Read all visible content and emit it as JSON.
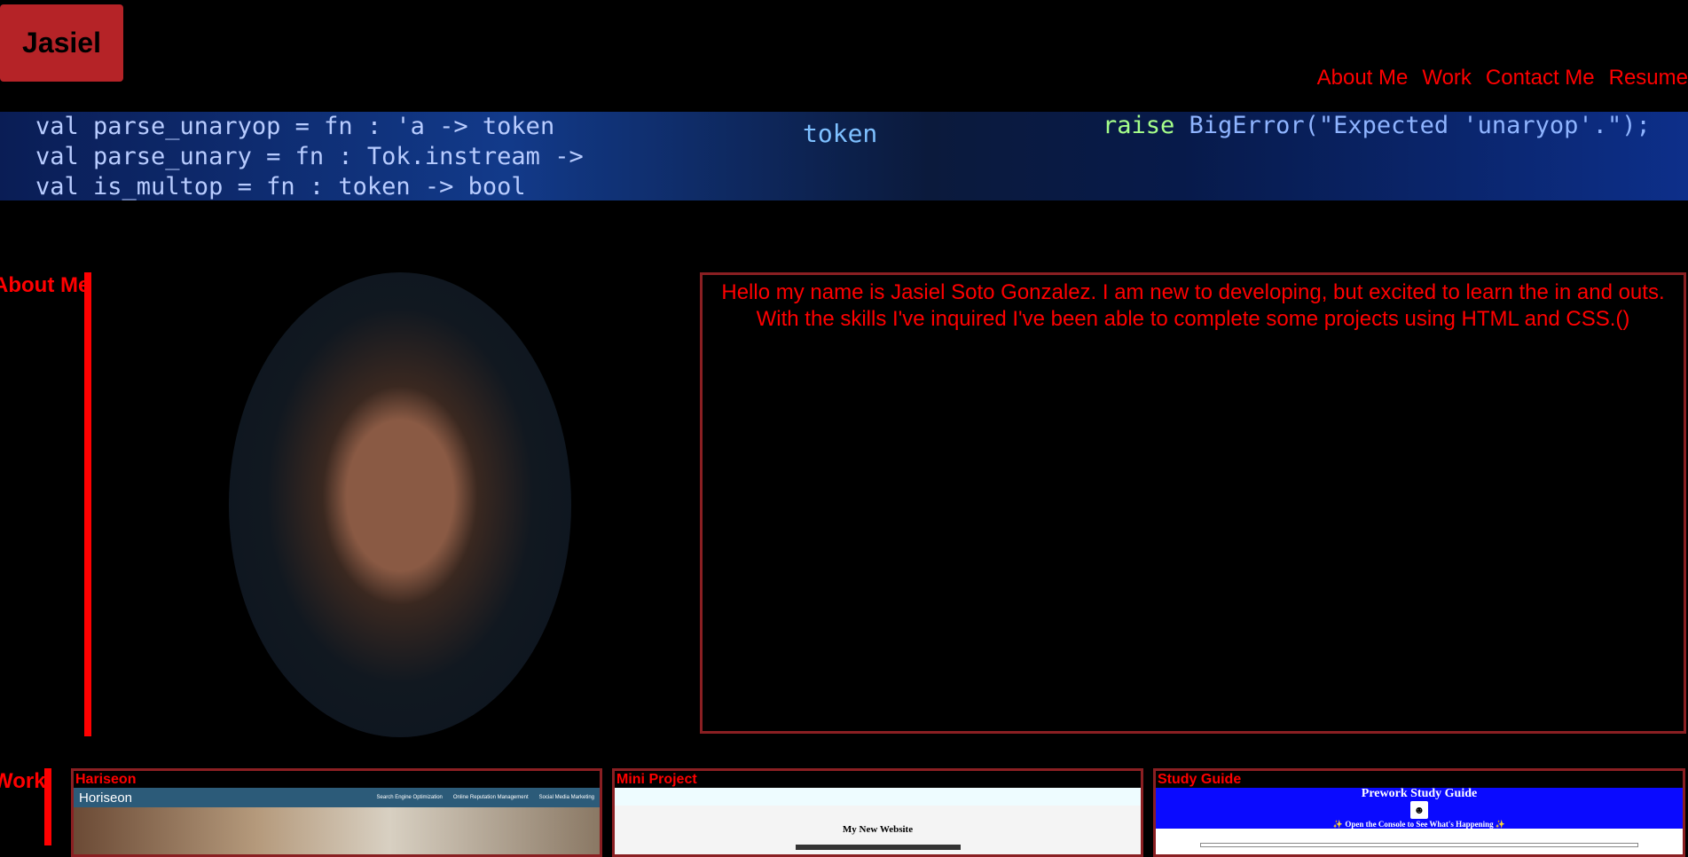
{
  "header": {
    "logo": "Jasiel",
    "nav": [
      "About Me",
      "Work",
      "Contact Me",
      "Resume"
    ]
  },
  "banner": {
    "code_left": [
      "val parse_unaryop = fn : 'a -> token",
      "val parse_unary = fn : Tok.instream ->",
      "val is_multop = fn : token -> bool"
    ],
    "code_middle": "token",
    "code_right_keyword": "raise",
    "code_right_rest": " BigError(\"Expected 'unaryop'.\");"
  },
  "about": {
    "label": "About Me",
    "text": "Hello my name is Jasiel Soto Gonzalez. I am new to developing, but excited to learn the in and outs. With the skills I've inquired I've been able to complete some projects using HTML and CSS.()"
  },
  "work": {
    "label": "Work",
    "cards": [
      {
        "title": "Hariseon",
        "preview_brand": "Horiseon",
        "preview_links": [
          "Search Engine Optimization",
          "Online Reputation Management",
          "Social Media Marketing"
        ]
      },
      {
        "title": "Mini Project",
        "preview_heading": "My New Website"
      },
      {
        "title": "Study Guide",
        "preview_heading": "Prework Study Guide",
        "preview_note": "✨ Open the Console to See What's Happening ✨"
      }
    ]
  },
  "colors": {
    "accent": "#ff0000",
    "logo_bg": "#b52327",
    "border": "#8a1f22",
    "background": "#000000"
  }
}
